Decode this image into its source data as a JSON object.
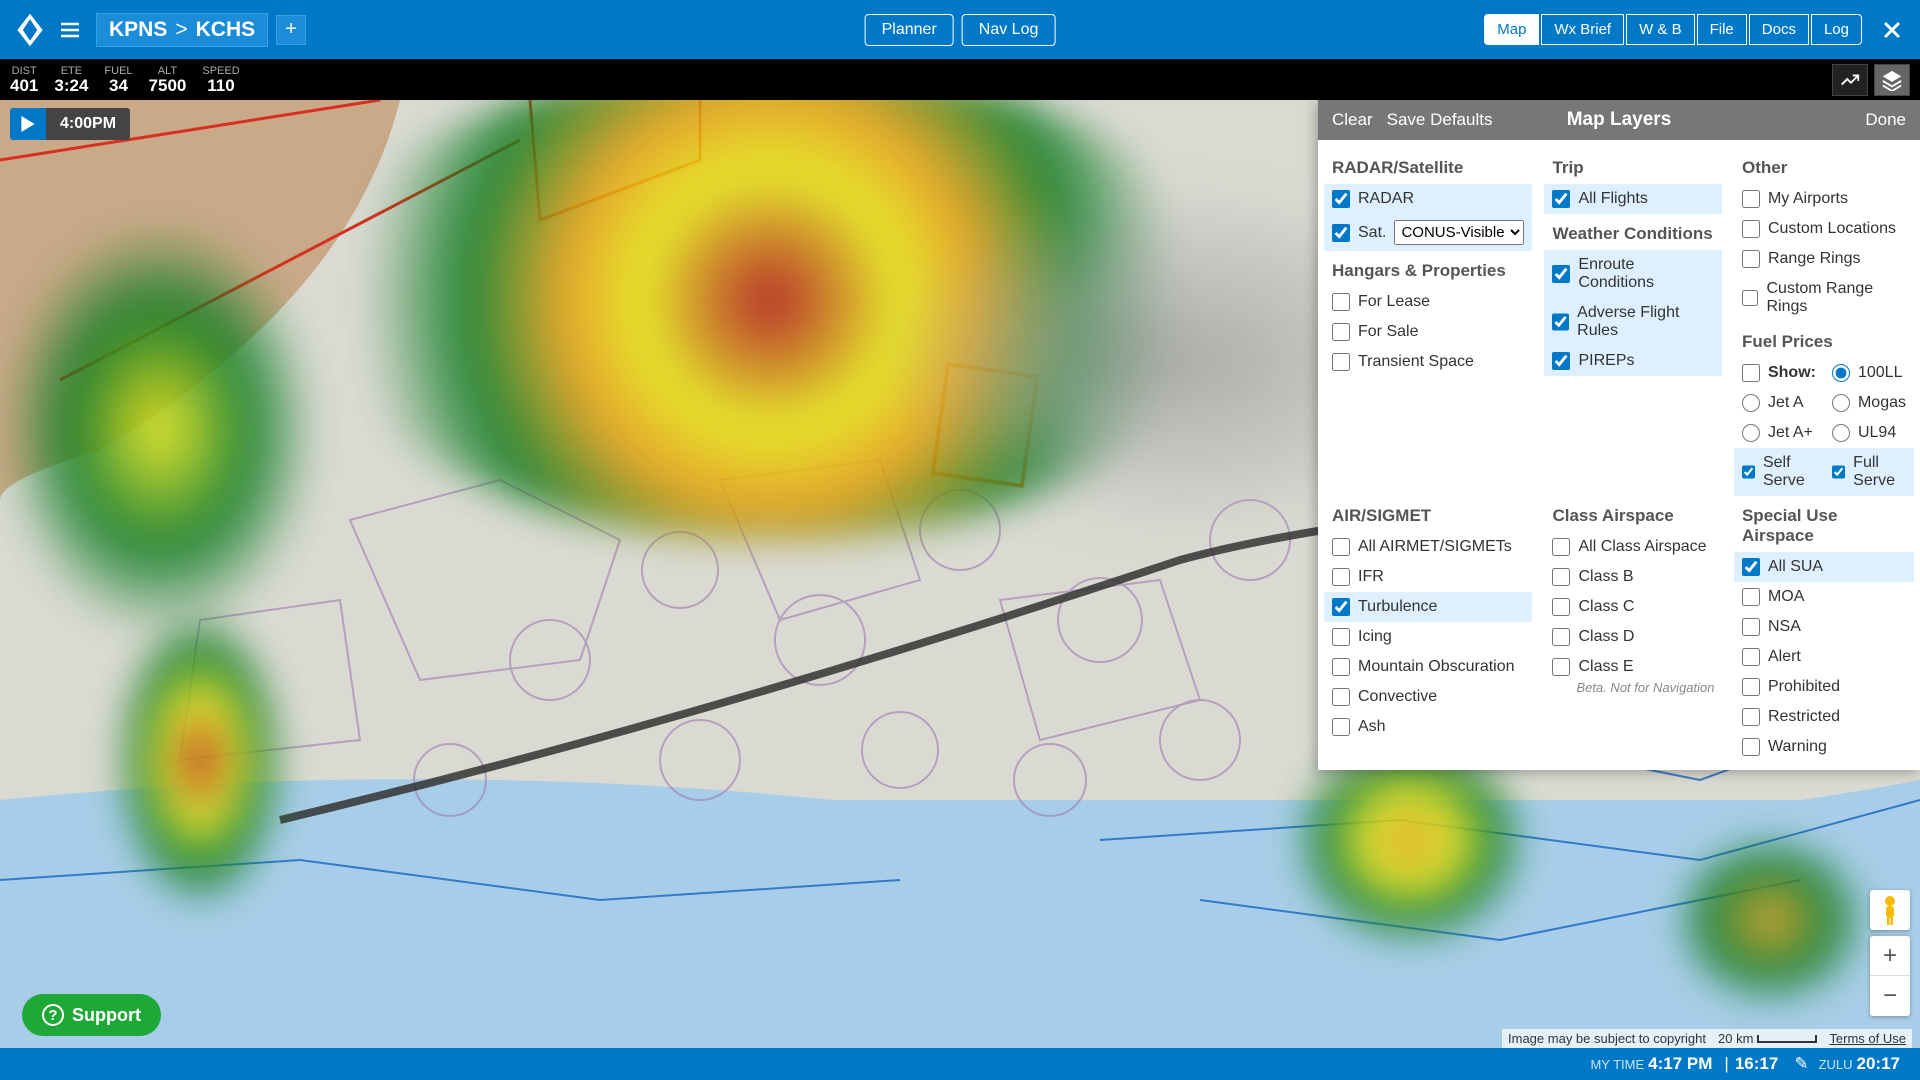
{
  "route": {
    "from": "KPNS",
    "to": "KCHS",
    "sep": ">"
  },
  "center_buttons": {
    "planner": "Planner",
    "navlog": "Nav Log"
  },
  "right_tabs": [
    "Map",
    "Wx Brief",
    "W & B",
    "File",
    "Docs",
    "Log"
  ],
  "right_tabs_active": 0,
  "info": {
    "dist": {
      "lbl": "DIST",
      "val": "401"
    },
    "ete": {
      "lbl": "ETE",
      "val": "3:24"
    },
    "fuel": {
      "lbl": "FUEL",
      "val": "34"
    },
    "alt": {
      "lbl": "ALT",
      "val": "7500"
    },
    "speed": {
      "lbl": "SPEED",
      "val": "110"
    }
  },
  "time_control": "4:00PM",
  "panel": {
    "clear": "Clear",
    "save": "Save Defaults",
    "title": "Map Layers",
    "done": "Done",
    "radar_sat": {
      "title": "RADAR/Satellite",
      "radar": "RADAR",
      "radar_on": true,
      "sat": "Sat.",
      "sat_on": true,
      "sat_sel": "CONUS-Visible"
    },
    "hangars": {
      "title": "Hangars & Properties",
      "items": [
        {
          "label": "For Lease",
          "on": false
        },
        {
          "label": "For Sale",
          "on": false
        },
        {
          "label": "Transient Space",
          "on": false
        }
      ]
    },
    "trip": {
      "title": "Trip",
      "items": [
        {
          "label": "All Flights",
          "on": true
        }
      ]
    },
    "wx": {
      "title": "Weather Conditions",
      "items": [
        {
          "label": "Enroute Conditions",
          "on": true
        },
        {
          "label": "Adverse Flight Rules",
          "on": true
        },
        {
          "label": "PIREPs",
          "on": true
        }
      ]
    },
    "other": {
      "title": "Other",
      "items": [
        {
          "label": "My Airports",
          "on": false
        },
        {
          "label": "Custom Locations",
          "on": false
        },
        {
          "label": "Range Rings",
          "on": false
        },
        {
          "label": "Custom Range Rings",
          "on": false
        }
      ]
    },
    "fuel": {
      "title": "Fuel Prices",
      "show_label": "Show:",
      "show_on": false,
      "types": [
        {
          "label": "100LL",
          "on": true
        },
        {
          "label": "Jet A",
          "on": false
        },
        {
          "label": "Mogas",
          "on": false
        },
        {
          "label": "Jet A+",
          "on": false
        },
        {
          "label": "UL94",
          "on": false
        }
      ],
      "serve": [
        {
          "label": "Self Serve",
          "on": true
        },
        {
          "label": "Full Serve",
          "on": true
        }
      ]
    },
    "airsig": {
      "title": "AIR/SIGMET",
      "items": [
        {
          "label": "All AIRMET/SIGMETs",
          "on": false
        },
        {
          "label": "IFR",
          "on": false
        },
        {
          "label": "Turbulence",
          "on": true
        },
        {
          "label": "Icing",
          "on": false
        },
        {
          "label": "Mountain Obscuration",
          "on": false
        },
        {
          "label": "Convective",
          "on": false
        },
        {
          "label": "Ash",
          "on": false
        }
      ]
    },
    "class_air": {
      "title": "Class Airspace",
      "items": [
        {
          "label": "All Class Airspace",
          "on": false
        },
        {
          "label": "Class B",
          "on": false
        },
        {
          "label": "Class C",
          "on": false
        },
        {
          "label": "Class D",
          "on": false
        },
        {
          "label": "Class E",
          "on": false
        }
      ],
      "beta": "Beta. Not for Navigation"
    },
    "sua": {
      "title": "Special Use Airspace",
      "items": [
        {
          "label": "All SUA",
          "on": true
        },
        {
          "label": "MOA",
          "on": false
        },
        {
          "label": "NSA",
          "on": false
        },
        {
          "label": "Alert",
          "on": false
        },
        {
          "label": "Prohibited",
          "on": false
        },
        {
          "label": "Restricted",
          "on": false
        },
        {
          "label": "Warning",
          "on": false
        }
      ]
    }
  },
  "attr": {
    "copy": "Image may be subject to copyright",
    "scale": "20 km",
    "terms": "Terms of Use"
  },
  "bottombar": {
    "my_lbl": "MY TIME",
    "my": "4:17 PM",
    "local": "16:17",
    "zulu_lbl": "ZULU",
    "zulu": "20:17"
  },
  "support": "Support"
}
